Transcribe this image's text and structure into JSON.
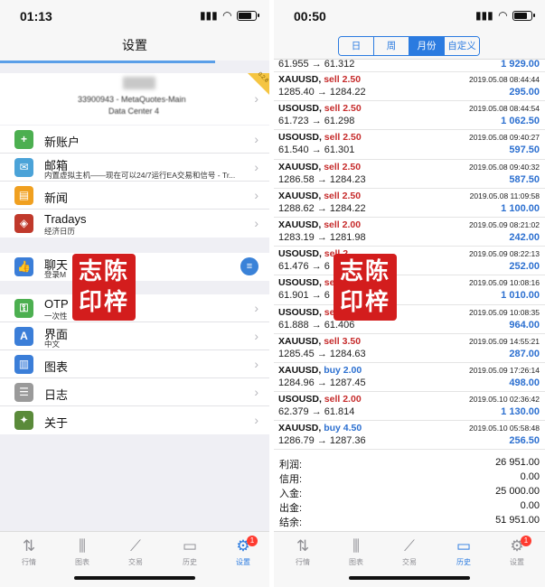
{
  "left": {
    "status": {
      "time": "01:13",
      "battery_level": 0.8
    },
    "title": "设置",
    "account": {
      "line1": "33900943 - MetaQuotes-Main",
      "line2": "Data Center 4",
      "ribbon": "0.2.8"
    },
    "items": [
      {
        "label": "新账户",
        "icon": "add-user-icon",
        "color": "#4caf50"
      },
      {
        "label": "邮箱",
        "sub": "内置虚拟主机——现在可以24/7运行EA交易和信号 - Tr...",
        "icon": "mail-icon",
        "color": "#4ba3d8"
      },
      {
        "label": "新闻",
        "icon": "book-icon",
        "color": "#f0a020"
      },
      {
        "label": "Tradays",
        "sub": "经济日历",
        "icon": "tradays-icon",
        "color": "#c0392b"
      }
    ],
    "chat": {
      "label": "聊天",
      "sub": "登录M"
    },
    "items2": [
      {
        "label": "OTP",
        "sub": "一次性",
        "icon": "key-icon",
        "color": "#4caf50"
      },
      {
        "label": "界面",
        "sub": "中文",
        "icon": "language-icon",
        "color": "#3b7ed8"
      },
      {
        "label": "图表",
        "icon": "chart-icon",
        "color": "#3b7ed8"
      },
      {
        "label": "日志",
        "icon": "journal-icon",
        "color": "#9a9a9a"
      },
      {
        "label": "关于",
        "icon": "about-icon",
        "color": "#5a8a3a"
      }
    ],
    "seal": [
      "志陈",
      "印梓"
    ],
    "tabs": [
      {
        "label": "行情",
        "icon": "quotes-icon"
      },
      {
        "label": "图表",
        "icon": "chart-tab-icon"
      },
      {
        "label": "交易",
        "icon": "trade-icon"
      },
      {
        "label": "历史",
        "icon": "history-icon"
      },
      {
        "label": "设置",
        "icon": "settings-icon",
        "badge": "1",
        "active": true
      }
    ]
  },
  "right": {
    "status": {
      "time": "00:50",
      "battery_level": 0.8
    },
    "segments": [
      "日",
      "周",
      "月份",
      "自定义"
    ],
    "active_segment": 2,
    "first_row": {
      "prices": "61.955 → 61.312",
      "pnl": "1 929.00"
    },
    "deals": [
      {
        "symbol": "XAUUSD",
        "side": "sell",
        "lot": "2.50",
        "time": "2019.05.08 08:44:44",
        "prices": "1285.40 → 1284.22",
        "pnl": "295.00"
      },
      {
        "symbol": "USOUSD",
        "side": "sell",
        "lot": "2.50",
        "time": "2019.05.08 08:44:54",
        "prices": "61.723 → 61.298",
        "pnl": "1 062.50"
      },
      {
        "symbol": "USOUSD",
        "side": "sell",
        "lot": "2.50",
        "time": "2019.05.08 09:40:27",
        "prices": "61.540 → 61.301",
        "pnl": "597.50"
      },
      {
        "symbol": "XAUUSD",
        "side": "sell",
        "lot": "2.50",
        "time": "2019.05.08 09:40:32",
        "prices": "1286.58 → 1284.23",
        "pnl": "587.50"
      },
      {
        "symbol": "XAUUSD",
        "side": "sell",
        "lot": "2.50",
        "time": "2019.05.08 11:09:58",
        "prices": "1288.62 → 1284.22",
        "pnl": "1 100.00"
      },
      {
        "symbol": "XAUUSD",
        "side": "sell",
        "lot": "2.00",
        "time": "2019.05.09 08:21:02",
        "prices": "1283.19 → 1281.98",
        "pnl": "242.00"
      },
      {
        "symbol": "USOUSD",
        "side": "sell",
        "lot": "2",
        "time": "2019.05.09 08:22:13",
        "prices": "61.476 → 6",
        "pnl": "252.00"
      },
      {
        "symbol": "USOUSD",
        "side": "sell",
        "lot": "2",
        "time": "2019.05.09 10:08:16",
        "prices": "61.901 → 6",
        "pnl": "1 010.00"
      },
      {
        "symbol": "USOUSD",
        "side": "sell",
        "lot": "2",
        "time": "2019.05.09 10:08:35",
        "prices": "61.888 → 61.406",
        "pnl": "964.00"
      },
      {
        "symbol": "XAUUSD",
        "side": "sell",
        "lot": "3.50",
        "time": "2019.05.09 14:55:21",
        "prices": "1285.45 → 1284.63",
        "pnl": "287.00"
      },
      {
        "symbol": "XAUUSD",
        "side": "buy",
        "lot": "2.00",
        "time": "2019.05.09 17:26:14",
        "prices": "1284.96 → 1287.45",
        "pnl": "498.00"
      },
      {
        "symbol": "USOUSD",
        "side": "sell",
        "lot": "2.00",
        "time": "2019.05.10 02:36:42",
        "prices": "62.379 → 61.814",
        "pnl": "1 130.00"
      },
      {
        "symbol": "XAUUSD",
        "side": "buy",
        "lot": "4.50",
        "time": "2019.05.10 05:58:48",
        "prices": "1286.79 → 1287.36",
        "pnl": "256.50"
      }
    ],
    "totals": [
      {
        "key": "利润:",
        "value": "26 951.00"
      },
      {
        "key": "信用:",
        "value": "0.00"
      },
      {
        "key": "入金:",
        "value": "25 000.00"
      },
      {
        "key": "出金:",
        "value": "0.00"
      },
      {
        "key": "结余:",
        "value": "51 951.00"
      }
    ],
    "seal": [
      "志陈",
      "印梓"
    ],
    "tabs": [
      {
        "label": "行情",
        "icon": "quotes-icon"
      },
      {
        "label": "图表",
        "icon": "chart-tab-icon"
      },
      {
        "label": "交易",
        "icon": "trade-icon"
      },
      {
        "label": "历史",
        "icon": "history-icon",
        "active": true
      },
      {
        "label": "设置",
        "icon": "settings-icon",
        "badge": "1"
      }
    ]
  }
}
